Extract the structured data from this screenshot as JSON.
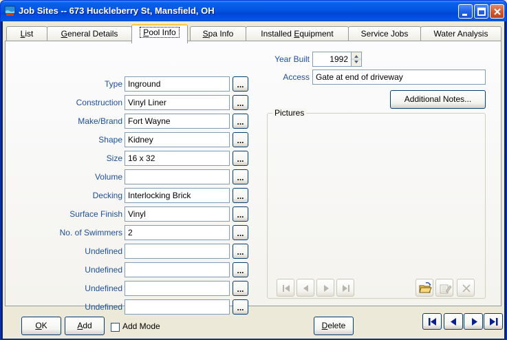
{
  "window": {
    "title": "Job Sites -- 673 Huckleberry St, Mansfield, OH"
  },
  "tabs": [
    {
      "label": "List",
      "accel": "L",
      "rest": "ist"
    },
    {
      "label": "General Details",
      "accel": "G",
      "rest": "eneral Details"
    },
    {
      "label": "Pool Info",
      "accel": "P",
      "rest": "ool Info"
    },
    {
      "label": "Spa Info",
      "accel": "S",
      "rest": "pa Info"
    },
    {
      "label": "Installed Equipment",
      "pre": "Installed ",
      "accel": "E",
      "rest": "quipment"
    },
    {
      "label": "Service Jobs"
    },
    {
      "label": "Water Analysis"
    }
  ],
  "fields": [
    {
      "label": "Type",
      "value": "Inground"
    },
    {
      "label": "Construction",
      "value": "Vinyl Liner"
    },
    {
      "label": "Make/Brand",
      "value": "Fort Wayne"
    },
    {
      "label": "Shape",
      "value": "Kidney"
    },
    {
      "label": "Size",
      "value": "16 x 32"
    },
    {
      "label": "Volume",
      "value": ""
    },
    {
      "label": "Decking",
      "value": "Interlocking Brick"
    },
    {
      "label": "Surface Finish",
      "value": "Vinyl"
    },
    {
      "label": "No. of Swimmers",
      "value": "2"
    },
    {
      "label": "Undefined",
      "value": ""
    },
    {
      "label": "Undefined",
      "value": ""
    },
    {
      "label": "Undefined",
      "value": ""
    },
    {
      "label": "Undefined",
      "value": ""
    }
  ],
  "ellipsis_label": "...",
  "year_built": {
    "label": "Year Built",
    "value": "1992"
  },
  "access": {
    "label": "Access",
    "value": "Gate at end of driveway"
  },
  "additional_notes_label": "Additional Notes...",
  "pictures": {
    "title": "Pictures"
  },
  "footer": {
    "ok": {
      "accel": "O",
      "rest": "K"
    },
    "add": {
      "accel": "A",
      "rest": "dd"
    },
    "add_mode": {
      "label": "Add Mode",
      "checked": false
    },
    "delete": {
      "accel": "D",
      "rest": "elete"
    }
  }
}
